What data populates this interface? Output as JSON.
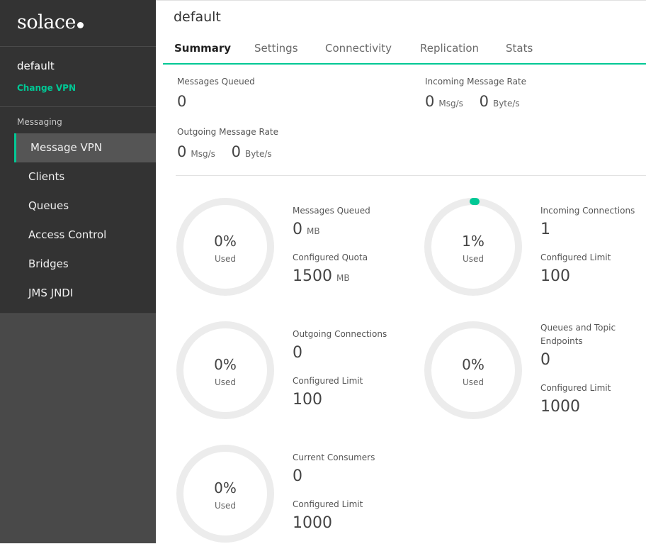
{
  "brand": {
    "logo_text": "solace",
    "accent_color": "#00c895"
  },
  "sidebar": {
    "vpn_name": "default",
    "change_vpn": "Change VPN",
    "section_label": "Messaging",
    "items": [
      {
        "label": "Message VPN",
        "active": true
      },
      {
        "label": "Clients"
      },
      {
        "label": "Queues"
      },
      {
        "label": "Access Control"
      },
      {
        "label": "Bridges"
      },
      {
        "label": "JMS JNDI"
      }
    ]
  },
  "header": {
    "title": "default"
  },
  "tabs": [
    {
      "label": "Summary",
      "active": true
    },
    {
      "label": "Settings"
    },
    {
      "label": "Connectivity"
    },
    {
      "label": "Replication"
    },
    {
      "label": "Stats"
    }
  ],
  "summary": {
    "messages_queued": {
      "label": "Messages Queued",
      "value": "0"
    },
    "incoming_rate": {
      "label": "Incoming Message Rate",
      "msg_value": "0",
      "msg_unit": "Msg/s",
      "byte_value": "0",
      "byte_unit": "Byte/s"
    },
    "outgoing_rate": {
      "label": "Outgoing Message Rate",
      "msg_value": "0",
      "msg_unit": "Msg/s",
      "byte_value": "0",
      "byte_unit": "Byte/s"
    }
  },
  "gauges": [
    {
      "percent_label": "0%",
      "used_label": "Used",
      "fraction": 0,
      "label1": "Messages Queued",
      "value1": "0",
      "unit1": "MB",
      "label2": "Configured Quota",
      "value2": "1500",
      "unit2": "MB"
    },
    {
      "percent_label": "1%",
      "used_label": "Used",
      "fraction": 0.01,
      "label1": "Incoming Connections",
      "value1": "1",
      "label2": "Configured Limit",
      "value2": "100"
    },
    {
      "percent_label": "0%",
      "used_label": "Used",
      "fraction": 0,
      "label1": "Outgoing Connections",
      "value1": "0",
      "label2": "Configured Limit",
      "value2": "100"
    },
    {
      "percent_label": "0%",
      "used_label": "Used",
      "fraction": 0,
      "label1": "Queues and Topic Endpoints",
      "value1": "0",
      "label2": "Configured Limit",
      "value2": "1000"
    },
    {
      "percent_label": "0%",
      "used_label": "Used",
      "fraction": 0,
      "label1": "Current Consumers",
      "value1": "0",
      "label2": "Configured Limit",
      "value2": "1000"
    }
  ]
}
